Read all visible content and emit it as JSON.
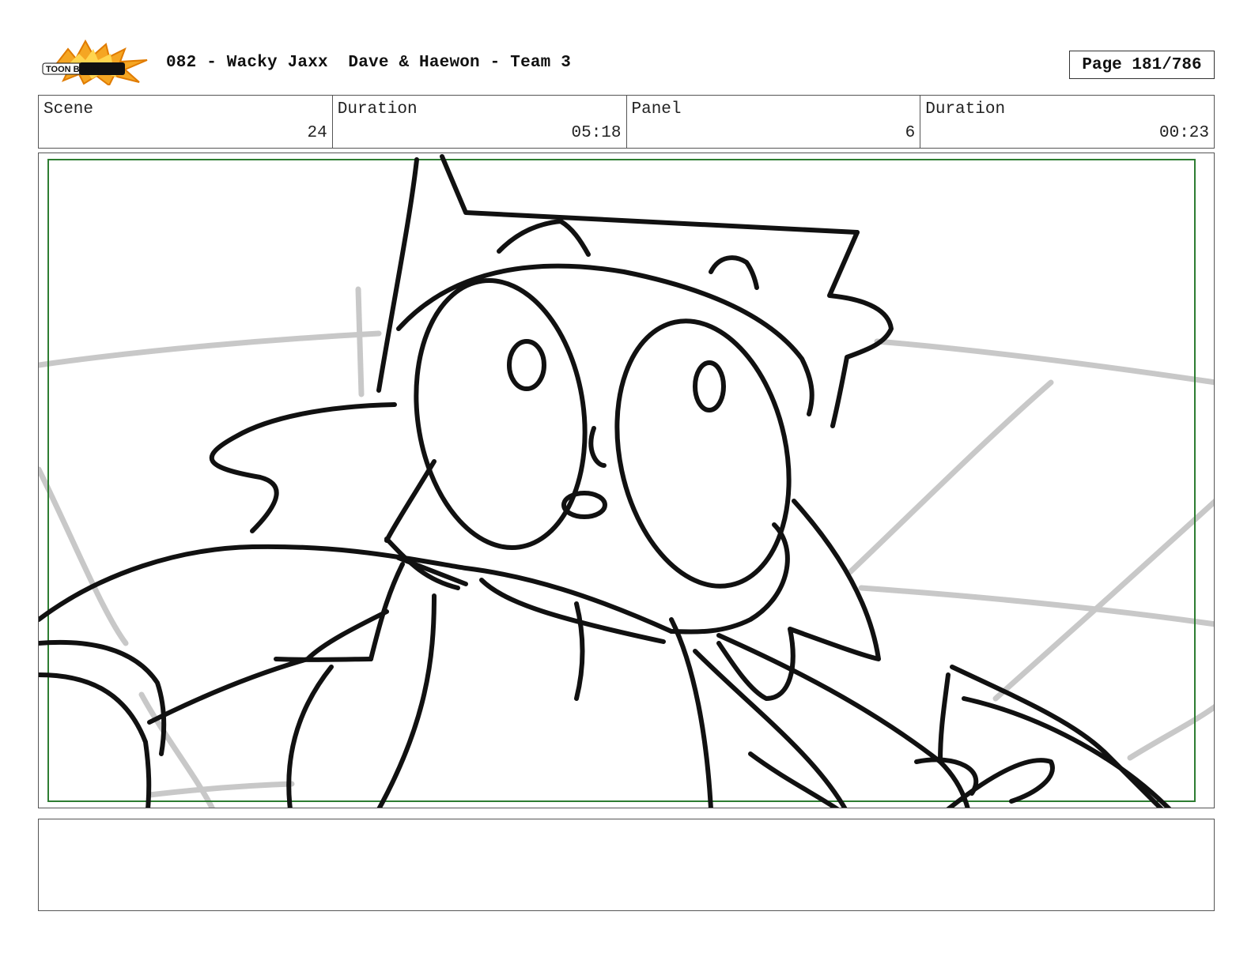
{
  "header": {
    "logo_text": "TOON BOOM",
    "title": "082 - Wacky Jaxx  Dave & Haewon - Team 3",
    "page_label": "Page 181/786"
  },
  "info": {
    "scene_label": "Scene",
    "scene_value": "24",
    "scene_duration_label": "Duration",
    "scene_duration_value": "05:18",
    "panel_label": "Panel",
    "panel_value": "6",
    "panel_duration_label": "Duration",
    "panel_duration_value": "00:23"
  },
  "panel": {
    "safe_frame_color": "#2e7d32"
  },
  "notes": {
    "text": ""
  }
}
